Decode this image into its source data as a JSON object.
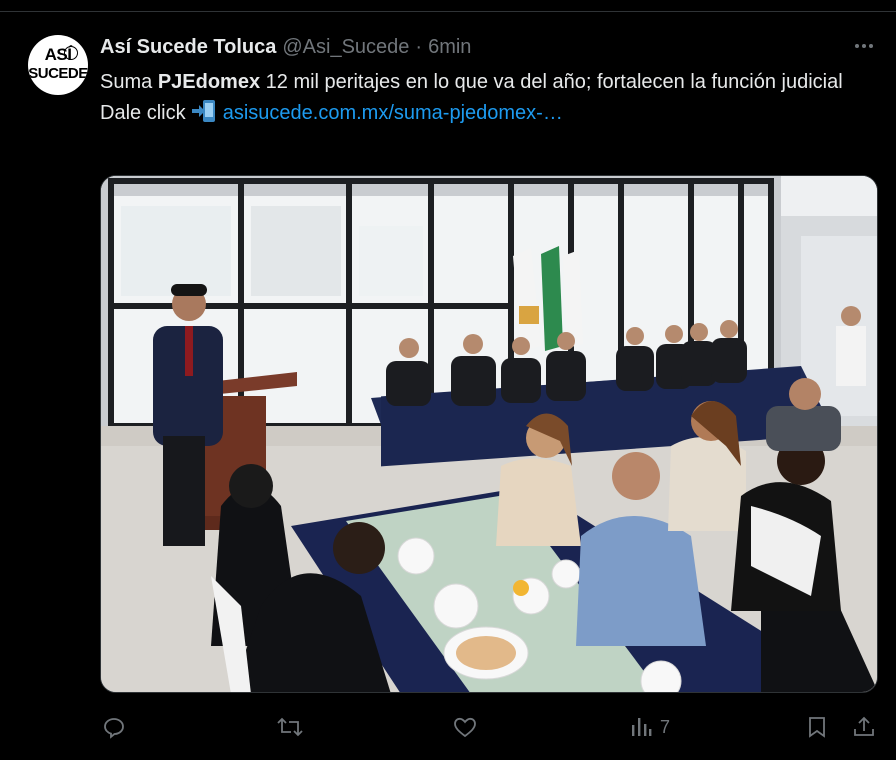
{
  "tweet": {
    "author_name": "Así Sucede Toluca",
    "handle": "@Asi_Sucede",
    "separator": "·",
    "time": "6min",
    "avatar_text_top": "ASÍ",
    "avatar_text_bottom": "SUCEDE",
    "text_prefix": "Suma ",
    "text_bold": "PJEdomex",
    "text_suffix": " 12 mil peritajes en lo que va del año; fortalecen la función judicial",
    "cta": "Dale click",
    "cta_emoji": "arrow-into-phone-emoji",
    "link": "asisucede.com.mx/suma-pjedomex-…",
    "photo_alt": "photo",
    "stats": {
      "views": "7"
    }
  },
  "icons": {
    "reply": "reply-icon",
    "retweet": "retweet-icon",
    "like": "like-icon",
    "views": "views-icon",
    "bookmark": "bookmark-icon",
    "share": "share-icon",
    "more": "more-icon"
  },
  "colors": {
    "background": "#000000",
    "text": "#e7e9ea",
    "muted": "#71767b",
    "link": "#1d9bf0"
  }
}
